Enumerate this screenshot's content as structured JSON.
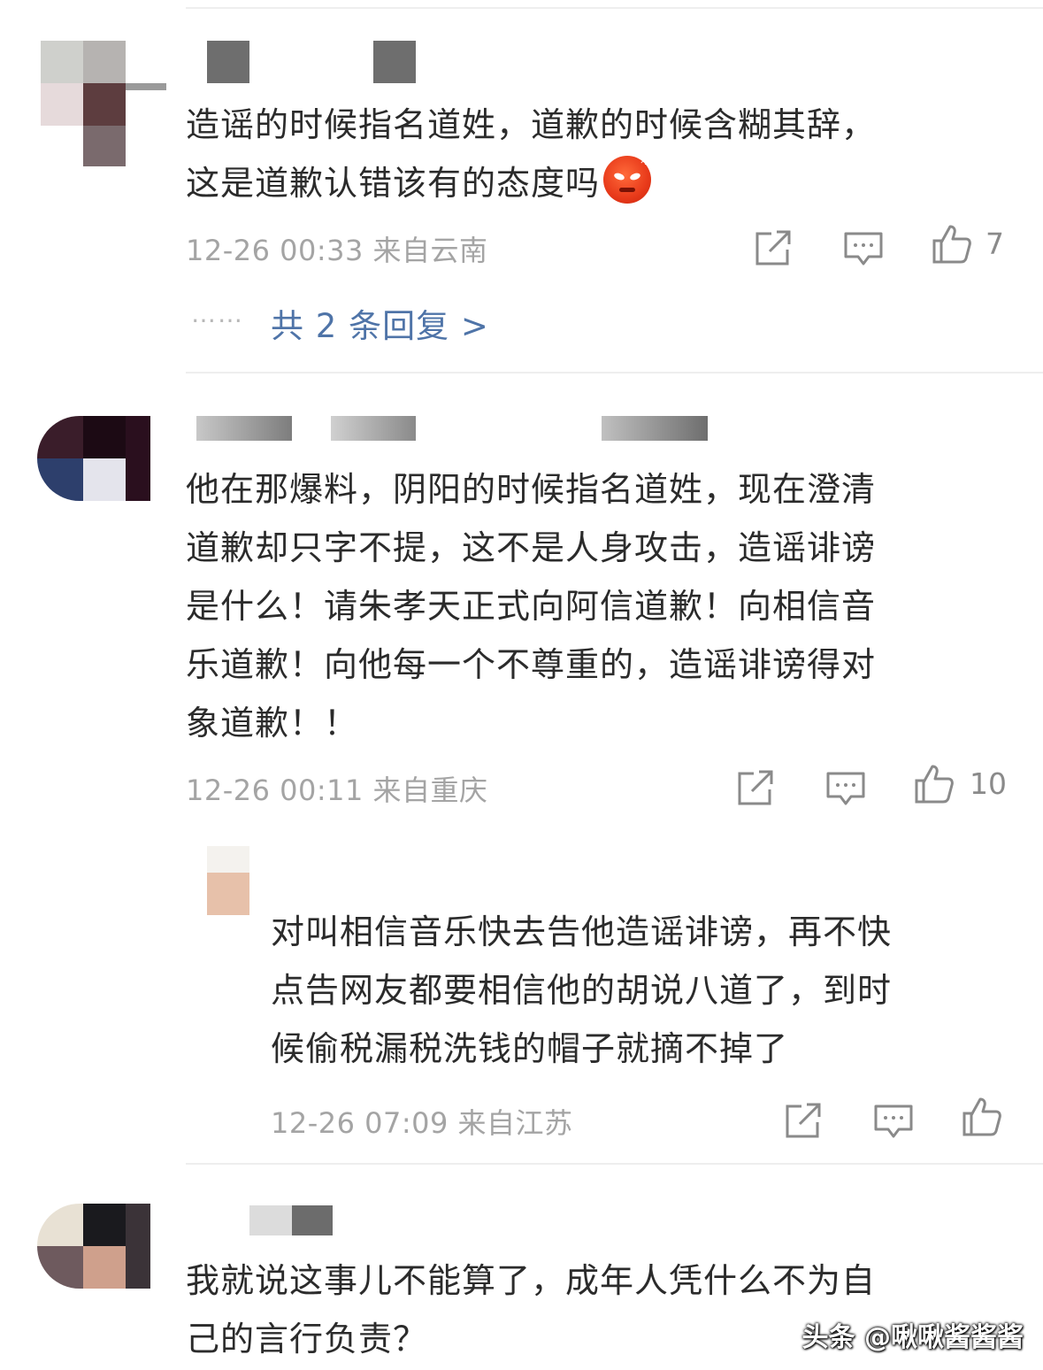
{
  "comments": [
    {
      "text_lines": [
        "造谣的时候指名道姓，道歉的时候含糊其辞，",
        "这是道歉认错该有的态度吗"
      ],
      "emoji": "angry-face-emoji",
      "meta": "12-26 00:33 来自云南",
      "likes": "7",
      "replies_link": "共 2 条回复 >",
      "dots": "……"
    },
    {
      "text_lines": [
        "他在那爆料，阴阳的时候指名道姓，现在澄清",
        "道歉却只字不提，这不是人身攻击，造谣诽谤",
        "是什么！请朱孝天正式向阿信道歉！向相信音",
        "乐道歉！向他每一个不尊重的，造谣诽谤得对",
        "象道歉！！"
      ],
      "meta": "12-26 00:11 来自重庆",
      "likes": "10",
      "reply": {
        "text_lines": [
          "对叫相信音乐快去告他造谣诽谤，再不快",
          "点告网友都要相信他的胡说八道了，到时",
          "候偷税漏税洗钱的帽子就摘不掉了"
        ],
        "meta": "12-26 07:09 来自江苏"
      }
    },
    {
      "text_lines": [
        "我就说这事儿不能算了，成年人凭什么不为自",
        "己的言行负责？"
      ]
    }
  ],
  "watermark": "头条 @啾啾酱酱酱",
  "icons": {
    "share": "share-icon",
    "comment": "comment-icon",
    "like": "thumbs-up-icon"
  },
  "colors": {
    "link": "#4f74a8",
    "meta": "#a4a4a4",
    "text": "#2b2b2b"
  }
}
